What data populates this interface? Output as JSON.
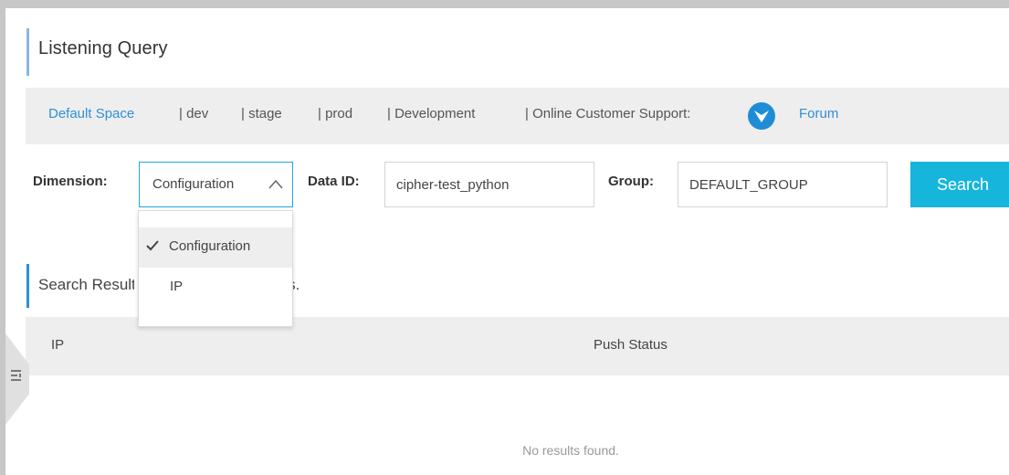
{
  "page": {
    "title": "Listening Query"
  },
  "namespaces": {
    "items": [
      "Default Space",
      "| dev",
      "| stage",
      "| prod",
      "| Development"
    ],
    "support_label": "| Online Customer Support:",
    "forum_label": "Forum"
  },
  "filters": {
    "dimension_label": "Dimension:",
    "dimension_value": "Configuration",
    "dimension_options": [
      "Configuration",
      "IP"
    ],
    "dataid_label": "Data ID:",
    "dataid_value": "cipher-test_python",
    "group_label": "Group:",
    "group_value": "DEFAULT_GROUP",
    "search_label": "Search"
  },
  "results": {
    "heading": "Search Results: 0 configuration items.",
    "columns": [
      "IP",
      "Push Status"
    ],
    "empty_text": "No results found."
  },
  "colors": {
    "accent": "#16b6dc",
    "link": "#2f8fd8",
    "support_icon": "#1f8dd6"
  }
}
